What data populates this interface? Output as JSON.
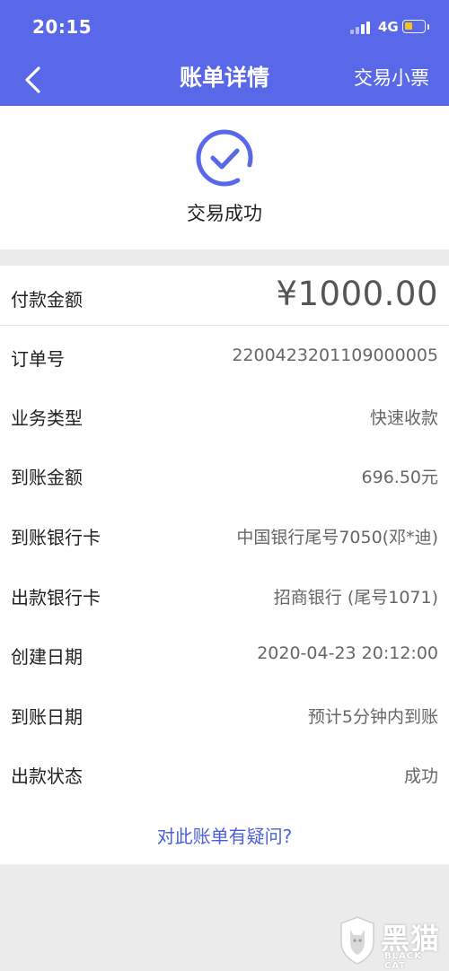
{
  "status_bar": {
    "time": "20:15",
    "network": "4G"
  },
  "nav": {
    "title": "账单详情",
    "action": "交易小票"
  },
  "result": {
    "text": "交易成功",
    "icon": "check-circle-icon"
  },
  "payment": {
    "label": "付款金额",
    "value": "¥1000.00"
  },
  "details": [
    {
      "label": "订单号",
      "value": "220042320110900000​5"
    },
    {
      "label": "业务类型",
      "value": "快速收款"
    },
    {
      "label": "到账金额",
      "value": "696.50元"
    },
    {
      "label": "到账银行卡",
      "value": "中国银行尾号7050(邓*迪)"
    },
    {
      "label": "出款银行卡",
      "value": "招商银行 (尾号1071)"
    },
    {
      "label": "创建日期",
      "value": "2020-04-23 20:12:00"
    },
    {
      "label": "到账日期",
      "value": "预计5分钟内到账"
    },
    {
      "label": "出款状态",
      "value": "成功"
    }
  ],
  "link": {
    "question": "对此账单有疑问?"
  },
  "watermark": {
    "text": "黑猫",
    "sub": "BLACK CAT"
  },
  "colors": {
    "primary": "#5868e8",
    "battery": "#f3c51b",
    "link": "#4a5fdc"
  }
}
